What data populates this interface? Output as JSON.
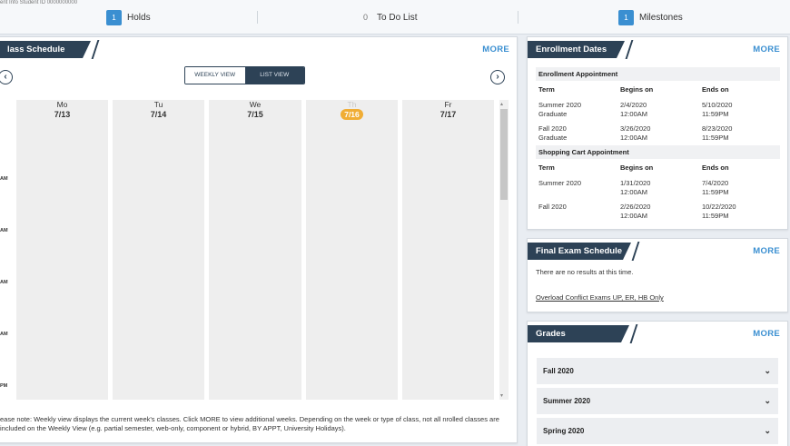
{
  "summary": {
    "crumb": "ent Info    Student ID 0000000000",
    "holds": {
      "count": "1",
      "label": "Holds"
    },
    "todo": {
      "count": "0",
      "label": "To Do List"
    },
    "milestones": {
      "count": "1",
      "label": "Milestones"
    }
  },
  "schedule": {
    "title": "lass Schedule",
    "more": "MORE",
    "prev_icon": "chevron-left-icon",
    "next_icon": "chevron-right-icon",
    "view_weekly": "WEEKLY VIEW",
    "view_list": "LIST VIEW",
    "days": [
      {
        "name": "Mo",
        "date": "7/13"
      },
      {
        "name": "Tu",
        "date": "7/14"
      },
      {
        "name": "We",
        "date": "7/15"
      },
      {
        "name": "Th",
        "date": "7/16",
        "today": true
      },
      {
        "name": "Fr",
        "date": "7/17"
      }
    ],
    "hours": [
      "AM",
      "AM",
      "AM",
      "AM",
      "PM"
    ],
    "note": "ease note: Weekly view displays the current week's classes. Click MORE to view additional weeks. Depending on the week or type of class, not all nrolled classes are included on the Weekly View (e.g. partial semester, web-only, component or hybrid, BY APPT, University Holidays)."
  },
  "enrollment": {
    "title": "Enrollment Dates",
    "more": "MORE",
    "appointment": {
      "heading": "Enrollment Appointment",
      "cols": [
        "Term",
        "Begins on",
        "Ends on"
      ],
      "rows": [
        {
          "term": "Summer 2020",
          "term2": "Graduate",
          "begin": "2/4/2020",
          "begin_time": "12:00AM",
          "end": "5/10/2020",
          "end_time": "11:59PM"
        },
        {
          "term": "Fall 2020",
          "term2": "Graduate",
          "begin": "3/26/2020",
          "begin_time": "12:00AM",
          "end": "8/23/2020",
          "end_time": "11:59PM"
        }
      ]
    },
    "cart": {
      "heading": "Shopping Cart Appointment",
      "cols": [
        "Term",
        "Begins on",
        "Ends on"
      ],
      "rows": [
        {
          "term": "Summer 2020",
          "begin": "1/31/2020",
          "begin_time": "12:00AM",
          "end": "7/4/2020",
          "end_time": "11:59PM"
        },
        {
          "term": "Fall 2020",
          "begin": "2/26/2020",
          "begin_time": "12:00AM",
          "end": "10/22/2020",
          "end_time": "11:59PM"
        }
      ]
    }
  },
  "final_exam": {
    "title": "Final Exam Schedule",
    "more": "MORE",
    "empty": "There are no results at this time.",
    "link": "Overload Conflict Exams UP, ER, HB Only"
  },
  "grades": {
    "title": "Grades",
    "more": "MORE",
    "terms": [
      "Fall 2020",
      "Summer 2020",
      "Spring 2020"
    ]
  },
  "colors": {
    "accent": "#3a8fd1",
    "header_dark": "#2d4256",
    "today": "#f0ad35"
  }
}
